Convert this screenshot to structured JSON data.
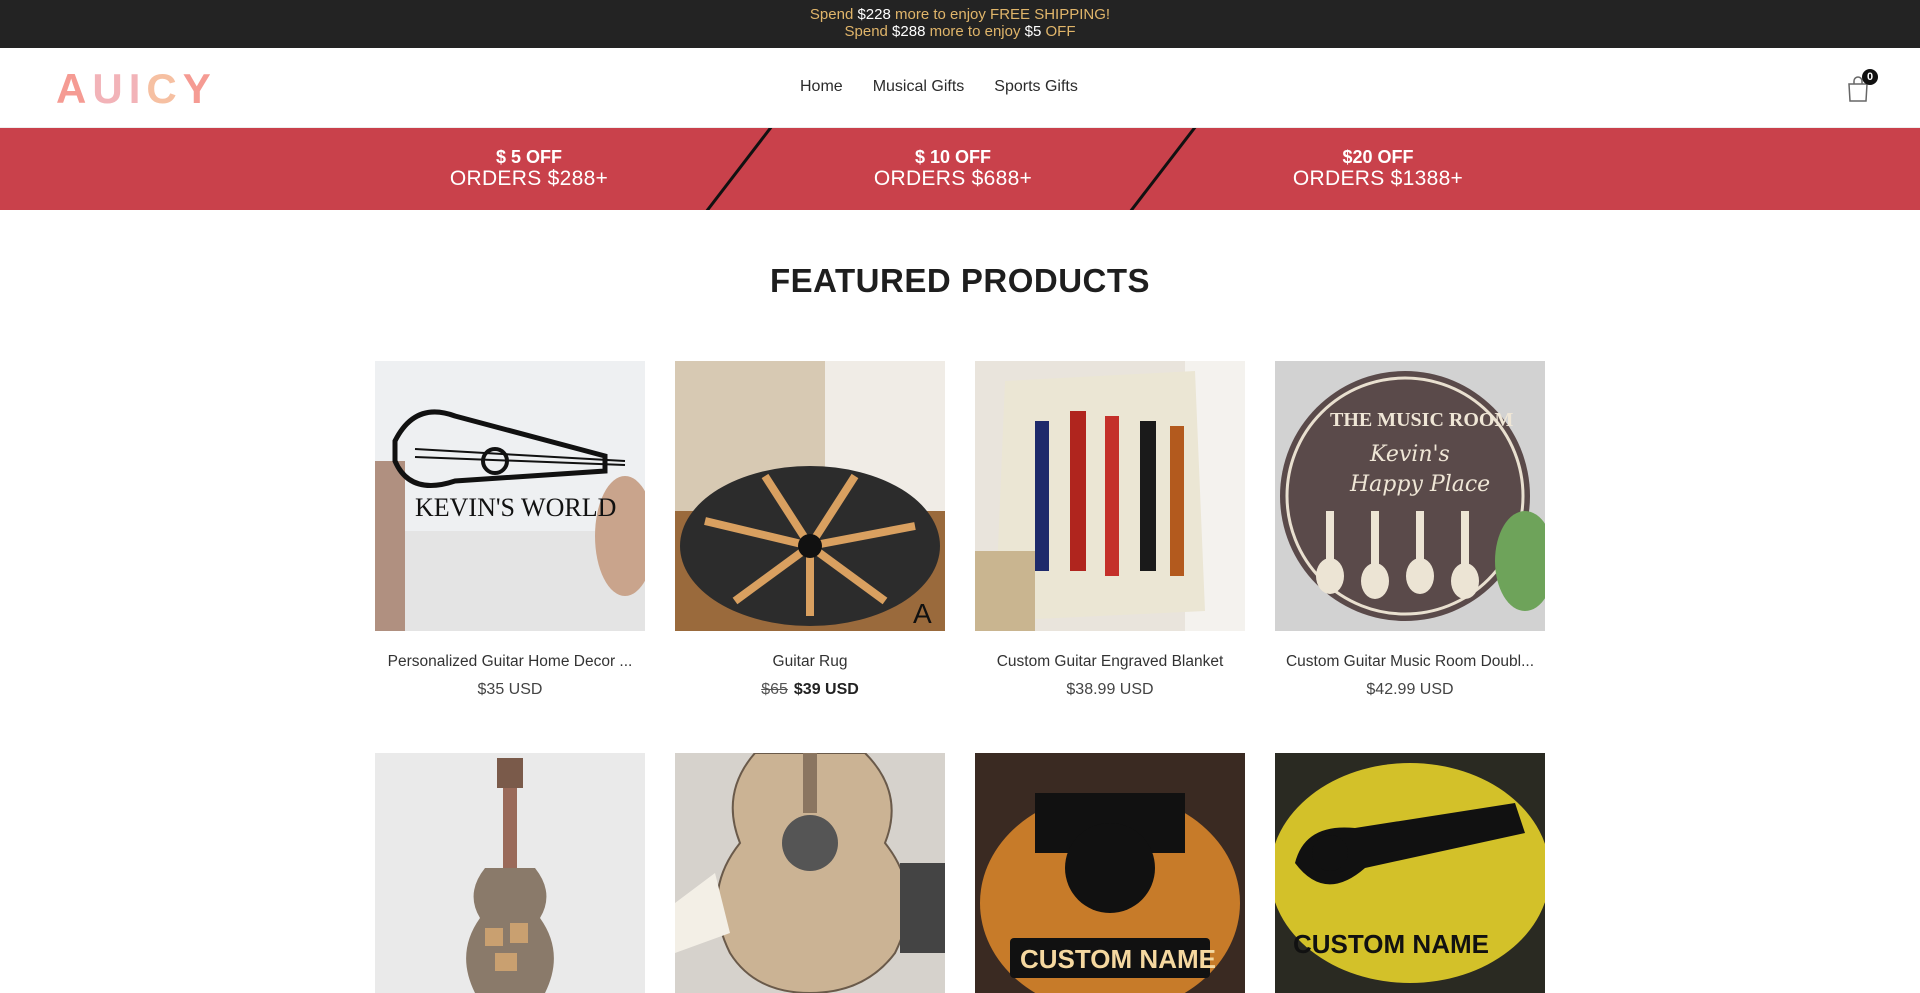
{
  "announcement": {
    "line1_prefix": "Spend ",
    "line1_amount": "$228",
    "line1_suffix": " more to enjoy FREE SHIPPING!",
    "line2_prefix": "Spend ",
    "line2_amount": "$288",
    "line2_mid": " more to enjoy ",
    "line2_discount": "$5",
    "line2_suffix": " OFF"
  },
  "header": {
    "logo_letters": [
      "A",
      "U",
      "I",
      "C",
      "Y"
    ],
    "nav": [
      "Home",
      "Musical Gifts",
      "Sports Gifts"
    ],
    "cart_count": "0"
  },
  "promo": [
    {
      "discount": "$ 5 OFF",
      "threshold": "ORDERS $288+"
    },
    {
      "discount": "$ 10 OFF",
      "threshold": "ORDERS $688+"
    },
    {
      "discount": "$20 OFF",
      "threshold": "ORDERS $1388+"
    }
  ],
  "featured": {
    "title": "FEATURED PRODUCTS",
    "products": [
      {
        "title": "Personalized Guitar Home Decor ...",
        "price": "$35 USD",
        "old_price": "",
        "image_text": "KEVIN'S WORLD"
      },
      {
        "title": "Guitar Rug",
        "price": "$39 USD",
        "old_price": "$65",
        "image_text": "A"
      },
      {
        "title": "Custom Guitar Engraved Blanket",
        "price": "$38.99 USD",
        "old_price": "",
        "image_text": ""
      },
      {
        "title": "Custom Guitar Music Room Doubl...",
        "price": "$42.99 USD",
        "old_price": "",
        "image_text": "THE MUSIC ROOM"
      },
      {
        "title": "",
        "price": "",
        "old_price": "",
        "image_text": ""
      },
      {
        "title": "",
        "price": "",
        "old_price": "",
        "image_text": ""
      },
      {
        "title": "",
        "price": "",
        "old_price": "",
        "image_text": "CUSTOM NAME"
      },
      {
        "title": "",
        "price": "",
        "old_price": "",
        "image_text": "CUSTOM NAME"
      }
    ],
    "image4_sub1": "Kevin's",
    "image4_sub2": "Happy Place"
  },
  "colors": {
    "topbar_bg": "#232323",
    "topbar_text": "#e0b56a",
    "promo_bg": "#c9414b",
    "logo": "#f4a6a0"
  }
}
